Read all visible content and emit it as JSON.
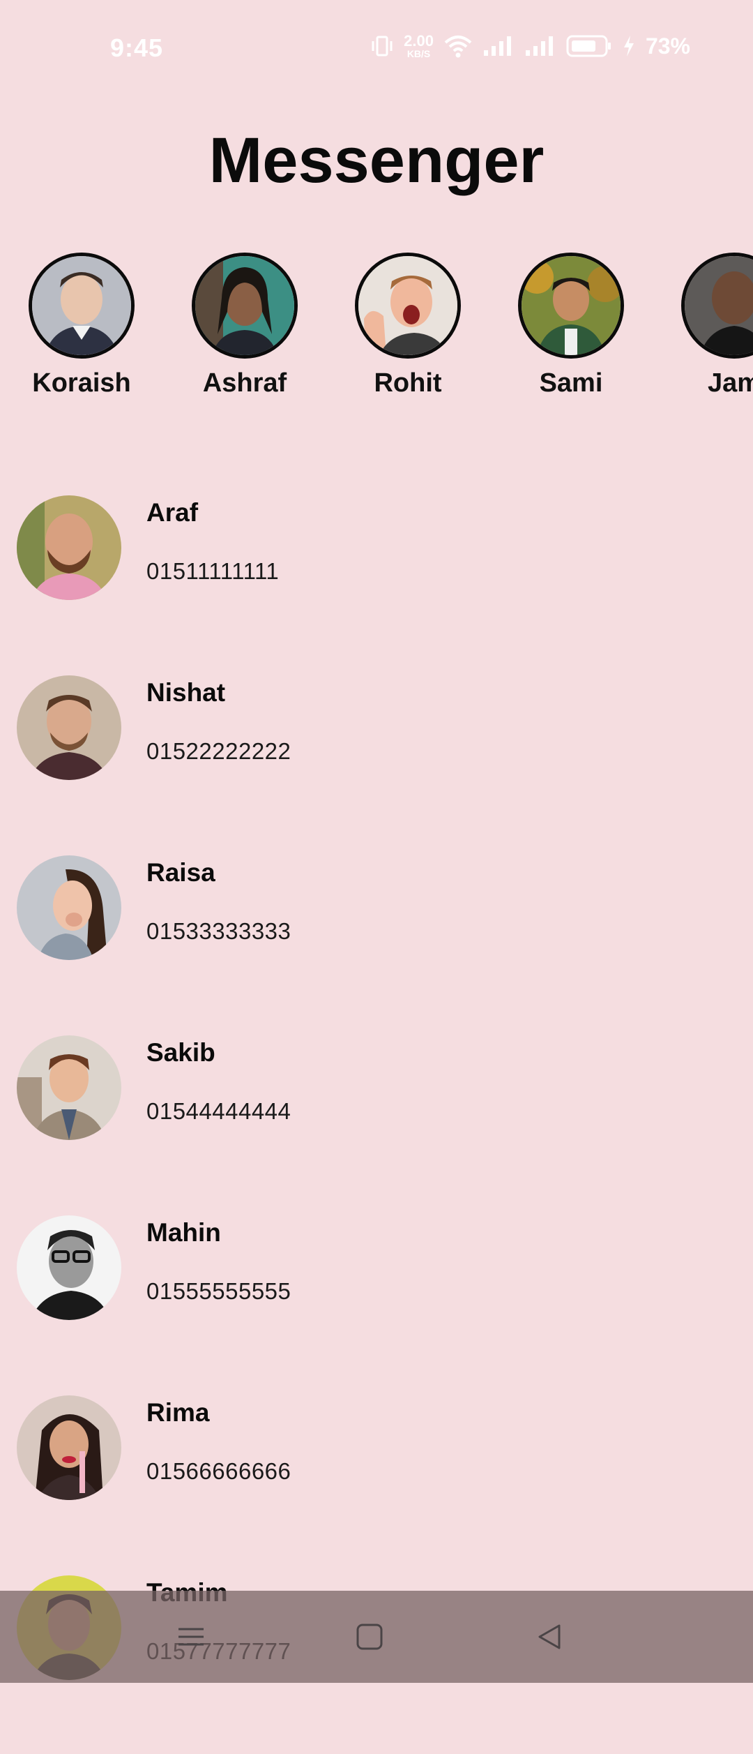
{
  "status_bar": {
    "time": "9:45",
    "speed_value": "2.00",
    "speed_unit": "KB/S",
    "battery_percent": "73%"
  },
  "app": {
    "title": "Messenger"
  },
  "stories": [
    {
      "name": "Koraish"
    },
    {
      "name": "Ashraf"
    },
    {
      "name": "Rohit"
    },
    {
      "name": "Sami"
    },
    {
      "name": "Jam"
    }
  ],
  "contacts": [
    {
      "name": "Araf",
      "phone": "01511111111"
    },
    {
      "name": "Nishat",
      "phone": "01522222222"
    },
    {
      "name": "Raisa",
      "phone": "01533333333"
    },
    {
      "name": "Sakib",
      "phone": "01544444444"
    },
    {
      "name": "Mahin",
      "phone": "01555555555"
    },
    {
      "name": "Rima",
      "phone": "01566666666"
    },
    {
      "name": "Tamim",
      "phone": "01577777777"
    }
  ],
  "colors": {
    "background": "#f5dde0",
    "text": "#111111",
    "nav_overlay": "#7a6466"
  },
  "icons": {
    "status": [
      "vibrate-icon",
      "wifi-icon",
      "signal-icon",
      "signal-icon",
      "battery-icon",
      "charging-icon"
    ],
    "nav": [
      "menu-icon",
      "home-square-icon",
      "back-triangle-icon"
    ]
  }
}
